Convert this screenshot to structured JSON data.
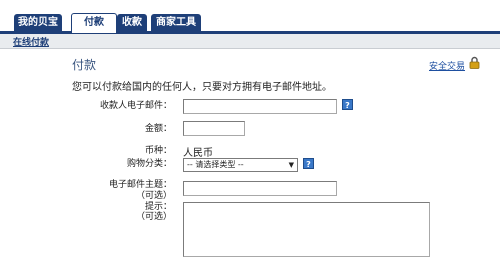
{
  "tabs": [
    {
      "label": "我的贝宝",
      "active": false
    },
    {
      "label": "付款",
      "active": true
    },
    {
      "label": "收款",
      "active": false
    },
    {
      "label": "商家工具",
      "active": false
    }
  ],
  "subnav": {
    "link": "在线付款"
  },
  "main": {
    "title": "付款",
    "intro": "您可以付款给国内的任何人，只要对方拥有电子邮件地址。",
    "secure_link": "安全交易"
  },
  "form": {
    "recipient_email_label": "收款人电子邮件：",
    "amount_label": "金额：",
    "currency_label": "币种：",
    "currency_value": "人民币",
    "category_label": "购物分类：",
    "category_selected": "-- 请选择类型 --",
    "subject_label": "电子邮件主题：",
    "subject_optional": "（可选）",
    "note_label": "提示：",
    "note_optional": "（可选）",
    "help_glyph": "?"
  },
  "colors": {
    "nav_blue": "#1e3f78",
    "help_blue": "#3a78c8",
    "lock_gold": "#d4a017"
  }
}
